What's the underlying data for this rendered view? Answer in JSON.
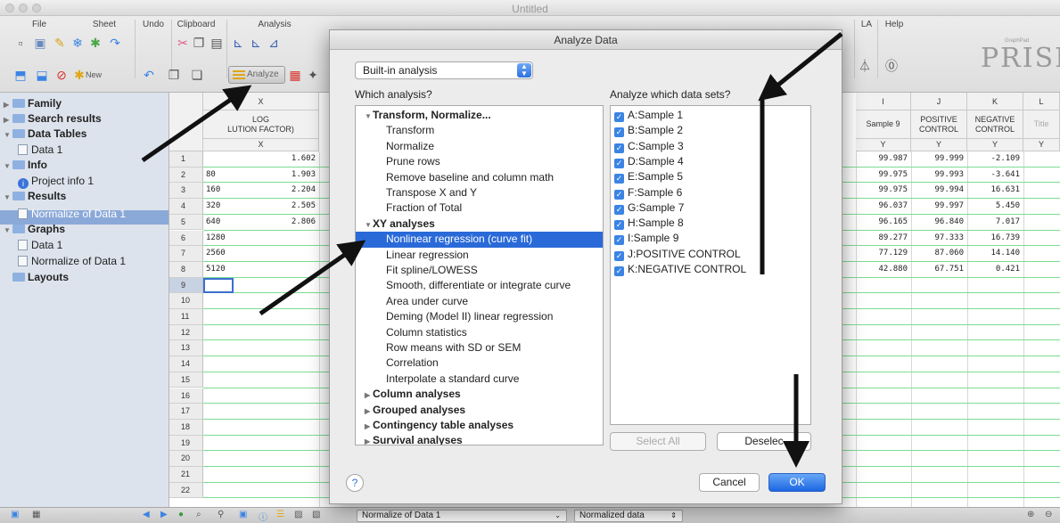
{
  "window": {
    "title": "Untitled"
  },
  "toolbar": {
    "groups": [
      "File",
      "Sheet",
      "Undo",
      "Clipboard",
      "Analysis",
      "LA",
      "Help"
    ],
    "new_label": "New",
    "analyze_label": "Analyze",
    "logo": "PRISM",
    "logo_small": "GraphPad"
  },
  "navigator": {
    "items": [
      {
        "label": "Family",
        "kind": "folder",
        "bold": true
      },
      {
        "label": "Search results",
        "kind": "folder",
        "bold": true
      },
      {
        "label": "Data Tables",
        "kind": "folder",
        "bold": true
      },
      {
        "label": "Data 1",
        "kind": "table",
        "bold": false
      },
      {
        "label": "Info",
        "kind": "folder",
        "bold": true
      },
      {
        "label": "Project info 1",
        "kind": "info",
        "bold": false
      },
      {
        "label": "Results",
        "kind": "folder",
        "bold": true
      },
      {
        "label": "Normalize of Data 1",
        "kind": "result",
        "bold": false
      },
      {
        "label": "Graphs",
        "kind": "folder",
        "bold": true
      },
      {
        "label": "Data 1",
        "kind": "graph",
        "bold": false
      },
      {
        "label": "Normalize of Data 1",
        "kind": "graph",
        "bold": false
      },
      {
        "label": "Layouts",
        "kind": "folder",
        "bold": true
      }
    ]
  },
  "sheet": {
    "col_x_header": "X",
    "col_x_title": "LOG",
    "col_x_title2": "LUTION FACTOR)",
    "col_x_sub": "X",
    "right_cols": [
      {
        "letter": "I",
        "title": "Sample 9",
        "title2": "",
        "sub": "Y"
      },
      {
        "letter": "J",
        "title": "POSITIVE",
        "title2": "CONTROL",
        "sub": "Y"
      },
      {
        "letter": "K",
        "title": "NEGATIVE",
        "title2": "CONTROL",
        "sub": "Y"
      },
      {
        "letter": "L",
        "title": "Title",
        "title2": "",
        "sub": "Y"
      }
    ],
    "row_numbers": [
      "1",
      "2",
      "3",
      "4",
      "5",
      "6",
      "7",
      "8",
      "9",
      "10",
      "11",
      "12",
      "13",
      "14",
      "15",
      "16",
      "17",
      "18",
      "19",
      "20",
      "21",
      "22"
    ],
    "left_values": [
      "",
      "80",
      "160",
      "320",
      "640",
      "1280",
      "2560",
      "5120"
    ],
    "x_values": [
      "1.602",
      "1.903",
      "2.204",
      "2.505",
      "2.806",
      "",
      "",
      ""
    ],
    "col_i": [
      "99.987",
      "99.975",
      "99.975",
      "96.037",
      "96.165",
      "89.277",
      "77.129",
      "42.880"
    ],
    "col_j": [
      "99.999",
      "99.993",
      "99.994",
      "99.997",
      "96.840",
      "97.333",
      "87.060",
      "67.751"
    ],
    "col_k": [
      "-2.109",
      "-3.641",
      "16.631",
      "5.450",
      "7.017",
      "16.739",
      "14.140",
      "0.421"
    ]
  },
  "bottombar": {
    "sheet_name": "Normalize of Data 1",
    "result_name": "Normalized data"
  },
  "dialog": {
    "title": "Analyze Data",
    "builtin": "Built-in analysis",
    "which_label": "Which analysis?",
    "datasets_label": "Analyze which data sets?",
    "analyses": [
      {
        "label": "Transform, Normalize...",
        "type": "cat",
        "open": true
      },
      {
        "label": "Transform",
        "type": "sub"
      },
      {
        "label": "Normalize",
        "type": "sub"
      },
      {
        "label": "Prune rows",
        "type": "sub"
      },
      {
        "label": "Remove baseline and column math",
        "type": "sub"
      },
      {
        "label": "Transpose X and Y",
        "type": "sub"
      },
      {
        "label": "Fraction of Total",
        "type": "sub"
      },
      {
        "label": "XY analyses",
        "type": "cat",
        "open": true
      },
      {
        "label": "Nonlinear regression (curve fit)",
        "type": "sub",
        "selected": true
      },
      {
        "label": "Linear regression",
        "type": "sub"
      },
      {
        "label": "Fit spline/LOWESS",
        "type": "sub"
      },
      {
        "label": "Smooth, differentiate or integrate curve",
        "type": "sub"
      },
      {
        "label": "Area under curve",
        "type": "sub"
      },
      {
        "label": "Deming (Model II) linear regression",
        "type": "sub"
      },
      {
        "label": "Column statistics",
        "type": "sub"
      },
      {
        "label": "Row means with SD or SEM",
        "type": "sub"
      },
      {
        "label": "Correlation",
        "type": "sub"
      },
      {
        "label": "Interpolate a standard curve",
        "type": "sub"
      },
      {
        "label": "Column analyses",
        "type": "cat",
        "open": false
      },
      {
        "label": "Grouped analyses",
        "type": "cat",
        "open": false
      },
      {
        "label": "Contingency table analyses",
        "type": "cat",
        "open": false
      },
      {
        "label": "Survival analyses",
        "type": "cat",
        "open": false
      }
    ],
    "datasets": [
      "A:Sample 1",
      "B:Sample 2",
      "C:Sample 3",
      "D:Sample 4",
      "E:Sample 5",
      "F:Sample 6",
      "G:Sample 7",
      "H:Sample 8",
      "I:Sample 9",
      "J:POSITIVE CONTROL",
      "K:NEGATIVE CONTROL"
    ],
    "select_all": "Select All",
    "deselect": "Deselec",
    "cancel": "Cancel",
    "ok": "OK",
    "help": "?"
  },
  "colors": {
    "accent": "#2a6ad8",
    "grid_line": "#7ddc93",
    "nav_bg": "#dde3ec"
  }
}
